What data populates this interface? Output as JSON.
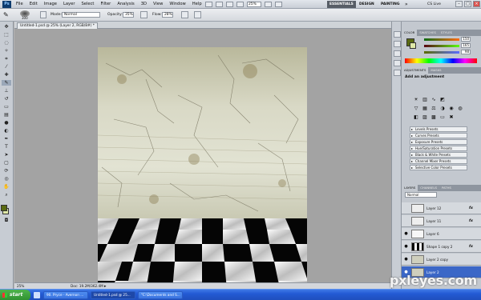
{
  "app": {
    "logo": "Ps"
  },
  "menu": [
    "File",
    "Edit",
    "Image",
    "Layer",
    "Select",
    "Filter",
    "Analysis",
    "3D",
    "View",
    "Window",
    "Help"
  ],
  "zoom_menu": "25%",
  "workspaces": [
    {
      "label": "ESSENTIALS",
      "active": true
    },
    {
      "label": "DESIGN",
      "active": false
    },
    {
      "label": "PAINTING",
      "active": false
    }
  ],
  "cslive": "CS Live",
  "options": {
    "brush_size": "300",
    "mode_label": "Mode:",
    "mode_value": "Normal",
    "opacity_label": "Opacity:",
    "opacity_value": "35%",
    "flow_label": "Flow:",
    "flow_value": "28%"
  },
  "document": {
    "tab_title": "Untitled-1.psd @ 25% (Layer 2, RGB/8#) *"
  },
  "status": {
    "zoom": "25%",
    "doc": "Doc: 19.2M/362.4M"
  },
  "colors": {
    "foreground": "#5a6b12",
    "background": "#dfe9a8",
    "accent_select": "#3b67c7"
  },
  "color_panel": {
    "tabs": [
      "COLOR",
      "SWATCHES",
      "STYLES"
    ],
    "values": [
      "150",
      "165",
      "98"
    ]
  },
  "adjustments": {
    "tabs": [
      "ADJUSTMENTS",
      "MASKS"
    ],
    "title": "Add an adjustment",
    "presets": [
      "Levels Presets",
      "Curves Presets",
      "Exposure Presets",
      "Hue/Saturation Presets",
      "Black & White Presets",
      "Channel Mixer Presets",
      "Selective Color Presets"
    ]
  },
  "layers_panel": {
    "tabs": [
      "LAYERS",
      "CHANNELS",
      "PATHS"
    ],
    "blend": "Normal",
    "layers": [
      {
        "name": "Layer 12",
        "fx": "fx",
        "selected": false,
        "visible": false
      },
      {
        "name": "Layer 11",
        "fx": "fx",
        "selected": false,
        "visible": false
      },
      {
        "name": "Layer 6",
        "fx": "",
        "selected": false,
        "visible": true
      },
      {
        "name": "Shape 1 copy 2",
        "fx": "fx",
        "selected": false,
        "visible": true
      },
      {
        "name": "Layer 2 copy",
        "fx": "",
        "selected": false,
        "visible": true
      },
      {
        "name": "Layer 2",
        "fx": "",
        "selected": true,
        "visible": true
      }
    ]
  },
  "taskbar": {
    "start": "start",
    "tasks": [
      {
        "label": "90. Pryce - Avernon ...",
        "active": false
      },
      {
        "label": "Untitled-1.psd @ 25...",
        "active": true
      },
      {
        "label": "\"C:\\Documents and S...",
        "active": false
      }
    ]
  },
  "watermark": "pxleyes.com"
}
